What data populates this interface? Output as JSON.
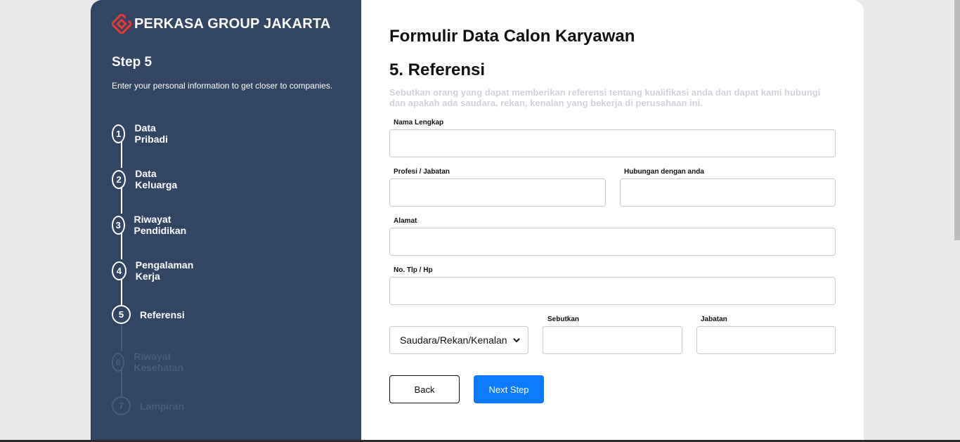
{
  "brand": {
    "name": "PERKASA GROUP JAKARTA",
    "logo_icon": "perkasa-logo-icon",
    "logo_color": "#e53935"
  },
  "sidebar": {
    "step_title": "Step 5",
    "step_desc": "Enter your personal information to get closer to companies.",
    "steps": [
      {
        "num": "1",
        "label": "Data Pribadi",
        "state": "done"
      },
      {
        "num": "2",
        "label": "Data Keluarga",
        "state": "done"
      },
      {
        "num": "3",
        "label": "Riwayat Pendidikan",
        "state": "done"
      },
      {
        "num": "4",
        "label": "Pengalaman Kerja",
        "state": "done"
      },
      {
        "num": "5",
        "label": "Referensi",
        "state": "active"
      },
      {
        "num": "6",
        "label": "Riwayat Kesehatan",
        "state": "inactive"
      },
      {
        "num": "7",
        "label": "Lampiran",
        "state": "inactive"
      }
    ]
  },
  "form": {
    "title": "Formulir Data Calon Karyawan",
    "section_title": "5. Referensi",
    "section_desc": "Sebutkan orang yang dapat memberikan referensi tentang kualifikasi anda dan dapat kami hubungi dan apakah ada saudara, rekan, kenalan yang bekerja di perusahaan ini.",
    "fields": {
      "nama_lengkap": {
        "label": "Nama Lengkap",
        "value": ""
      },
      "profesi": {
        "label": "Profesi / Jabatan",
        "value": ""
      },
      "hubungan": {
        "label": "Hubungan dengan anda",
        "value": ""
      },
      "alamat": {
        "label": "Alamat",
        "value": ""
      },
      "no_tlp": {
        "label": "No. Tlp / Hp",
        "value": ""
      },
      "relasi_select": {
        "value": "Saudara/Rekan/Kenalan"
      },
      "sebutkan": {
        "label": "Sebutkan",
        "value": ""
      },
      "jabatan": {
        "label": "Jabatan",
        "value": ""
      }
    },
    "buttons": {
      "back": "Back",
      "next": "Next Step"
    }
  },
  "colors": {
    "sidebar_bg": "#324562",
    "accent": "#0d7bff",
    "page_bg": "#e9e9e9"
  }
}
